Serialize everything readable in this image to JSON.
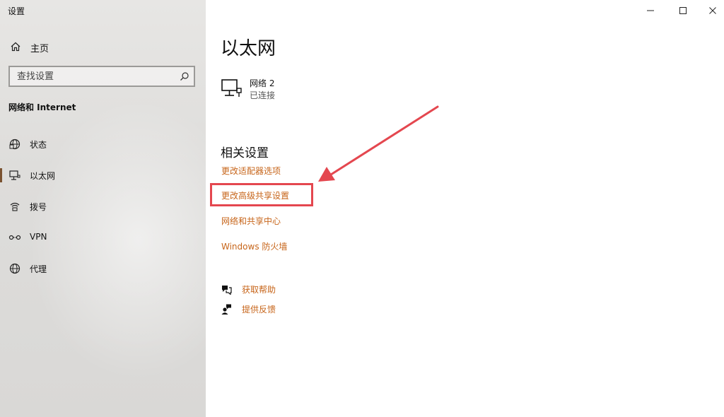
{
  "window": {
    "title": "设置",
    "buttons": {
      "minimize": "minimize",
      "maximize": "maximize",
      "close": "close"
    }
  },
  "sidebar": {
    "home_label": "主页",
    "search_placeholder": "查找设置",
    "section_title": "网络和 Internet",
    "items": [
      {
        "label": "状态",
        "icon": "globe-status-icon",
        "active": false
      },
      {
        "label": "以太网",
        "icon": "ethernet-icon",
        "active": true
      },
      {
        "label": "拨号",
        "icon": "dialup-icon",
        "active": false
      },
      {
        "label": "VPN",
        "icon": "vpn-icon",
        "active": false
      },
      {
        "label": "代理",
        "icon": "globe-icon",
        "active": false
      }
    ]
  },
  "main": {
    "title": "以太网",
    "network": {
      "name": "网络 2",
      "status": "已连接"
    },
    "related_title": "相关设置",
    "links": [
      {
        "label": "更改适配器选项"
      },
      {
        "label": "更改高级共享设置",
        "highlighted": true
      },
      {
        "label": "网络和共享中心"
      },
      {
        "label": "Windows 防火墙"
      }
    ],
    "help": [
      {
        "label": "获取帮助",
        "icon": "help-chat-icon"
      },
      {
        "label": "提供反馈",
        "icon": "feedback-icon"
      }
    ]
  },
  "colors": {
    "accent_link": "#c7651a",
    "annotation_red": "#e4474f",
    "active_indicator": "#7a5230"
  }
}
